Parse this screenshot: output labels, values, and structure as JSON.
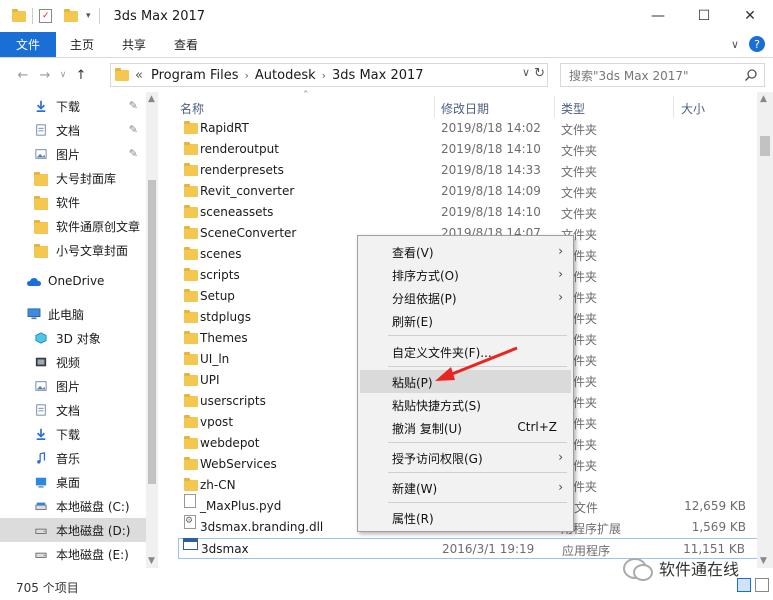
{
  "window": {
    "title": "3ds Max 2017",
    "minimize": "—",
    "maximize": "☐",
    "close": "✕"
  },
  "ribbon": {
    "tabs": [
      "文件",
      "主页",
      "共享",
      "查看"
    ],
    "expand": "∨",
    "help": "?"
  },
  "address": {
    "back": "←",
    "forward": "→",
    "recent": "∨",
    "up": "↑",
    "overflow": "«",
    "crumbs": [
      "Program Files",
      "Autodesk",
      "3ds Max 2017"
    ],
    "search_placeholder": "搜索\"3ds Max 2017\""
  },
  "nav": {
    "items": [
      {
        "label": "下载",
        "icon": "download-icon",
        "pinned": true
      },
      {
        "label": "文档",
        "icon": "document-icon",
        "pinned": true
      },
      {
        "label": "图片",
        "icon": "pictures-icon",
        "pinned": true
      },
      {
        "label": "大号封面库",
        "icon": "folder-icon",
        "pinned": false
      },
      {
        "label": "软件",
        "icon": "folder-icon",
        "pinned": false
      },
      {
        "label": "软件通原创文章",
        "icon": "folder-icon",
        "pinned": false
      },
      {
        "label": "小号文章封面",
        "icon": "folder-icon",
        "pinned": false
      },
      {
        "label": "OneDrive",
        "icon": "cloud-icon",
        "pinned": false
      },
      {
        "label": "此电脑",
        "icon": "computer-icon",
        "pinned": false
      },
      {
        "label": "3D 对象",
        "icon": "3d-objects-icon",
        "pinned": false
      },
      {
        "label": "视频",
        "icon": "video-icon",
        "pinned": false
      },
      {
        "label": "图片",
        "icon": "pictures-icon",
        "pinned": false
      },
      {
        "label": "文档",
        "icon": "document-icon",
        "pinned": false
      },
      {
        "label": "下载",
        "icon": "download-icon",
        "pinned": false
      },
      {
        "label": "音乐",
        "icon": "music-icon",
        "pinned": false
      },
      {
        "label": "桌面",
        "icon": "desktop-icon",
        "pinned": false
      },
      {
        "label": "本地磁盘 (C:)",
        "icon": "drive-icon",
        "pinned": false
      },
      {
        "label": "本地磁盘 (D:)",
        "icon": "drive-icon",
        "pinned": false,
        "selected": true
      },
      {
        "label": "本地磁盘 (E:)",
        "icon": "drive-icon",
        "pinned": false
      }
    ]
  },
  "columns": {
    "name": "名称",
    "date": "修改日期",
    "type": "类型",
    "size": "大小"
  },
  "files": [
    {
      "name": "RapidRT",
      "date": "2019/8/18 14:02",
      "type": "文件夹",
      "size": "",
      "kind": "folder"
    },
    {
      "name": "renderoutput",
      "date": "2019/8/18 14:10",
      "type": "文件夹",
      "size": "",
      "kind": "folder"
    },
    {
      "name": "renderpresets",
      "date": "2019/8/18 14:33",
      "type": "文件夹",
      "size": "",
      "kind": "folder"
    },
    {
      "name": "Revit_converter",
      "date": "2019/8/18 14:09",
      "type": "文件夹",
      "size": "",
      "kind": "folder"
    },
    {
      "name": "sceneassets",
      "date": "2019/8/18 14:10",
      "type": "文件夹",
      "size": "",
      "kind": "folder"
    },
    {
      "name": "SceneConverter",
      "date": "2019/8/18 14:07",
      "type": "文件夹",
      "size": "",
      "kind": "folder"
    },
    {
      "name": "scenes",
      "date": "",
      "type": "文件夹",
      "size": "",
      "kind": "folder"
    },
    {
      "name": "scripts",
      "date": "",
      "type": "文件夹",
      "size": "",
      "kind": "folder"
    },
    {
      "name": "Setup",
      "date": "",
      "type": "文件夹",
      "size": "",
      "kind": "folder"
    },
    {
      "name": "stdplugs",
      "date": "",
      "type": "文件夹",
      "size": "",
      "kind": "folder"
    },
    {
      "name": "Themes",
      "date": "",
      "type": "文件夹",
      "size": "",
      "kind": "folder"
    },
    {
      "name": "UI_ln",
      "date": "",
      "type": "文件夹",
      "size": "",
      "kind": "folder"
    },
    {
      "name": "UPI",
      "date": "",
      "type": "文件夹",
      "size": "",
      "kind": "folder"
    },
    {
      "name": "userscripts",
      "date": "",
      "type": "文件夹",
      "size": "",
      "kind": "folder"
    },
    {
      "name": "vpost",
      "date": "",
      "type": "文件夹",
      "size": "",
      "kind": "folder"
    },
    {
      "name": "webdepot",
      "date": "",
      "type": "文件夹",
      "size": "",
      "kind": "folder"
    },
    {
      "name": "WebServices",
      "date": "",
      "type": "文件夹",
      "size": "",
      "kind": "folder"
    },
    {
      "name": "zh-CN",
      "date": "",
      "type": "文件夹",
      "size": "",
      "kind": "folder"
    },
    {
      "name": "_MaxPlus.pyd",
      "date": "",
      "type": "D 文件",
      "size": "12,659 KB",
      "kind": "file"
    },
    {
      "name": "3dsmax.branding.dll",
      "date": "",
      "type": "用程序扩展",
      "size": "1,569 KB",
      "kind": "dll"
    },
    {
      "name": "3dsmax",
      "date": "2016/3/1 19:19",
      "type": "应用程序",
      "size": "11,151 KB",
      "kind": "app"
    }
  ],
  "context_menu": {
    "items": [
      {
        "label": "查看(V)",
        "submenu": true
      },
      {
        "label": "排序方式(O)",
        "submenu": true
      },
      {
        "label": "分组依据(P)",
        "submenu": true
      },
      {
        "label": "刷新(E)",
        "submenu": false
      },
      {
        "label": "自定义文件夹(F)...",
        "submenu": false
      },
      {
        "label": "粘贴(P)",
        "submenu": false,
        "highlighted": true
      },
      {
        "label": "粘贴快捷方式(S)",
        "submenu": false
      },
      {
        "label": "撤消 复制(U)",
        "submenu": false,
        "shortcut": "Ctrl+Z"
      },
      {
        "label": "授予访问权限(G)",
        "submenu": true
      },
      {
        "label": "新建(W)",
        "submenu": true
      },
      {
        "label": "属性(R)",
        "submenu": false
      }
    ]
  },
  "status": {
    "count": "705 个项目"
  },
  "watermark": {
    "text": "软件通在线"
  },
  "colors": {
    "accent": "#1a6fd6",
    "folder": "#f3c750",
    "annotation": "#e8251f"
  }
}
